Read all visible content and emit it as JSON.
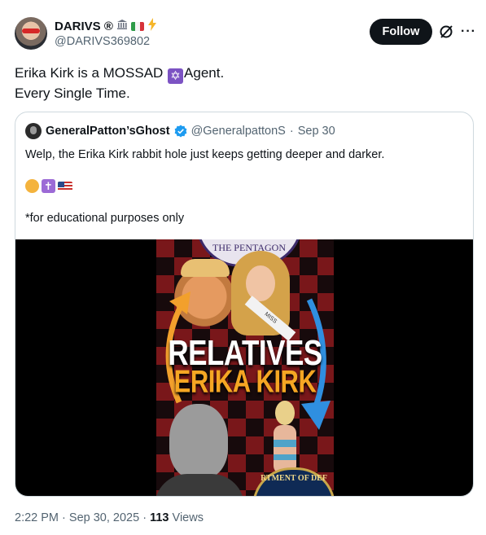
{
  "author": {
    "display_name": "DARIVS ®",
    "handle": "@DARIVS369802",
    "name_emojis": [
      "classical-building",
      "italy-flag",
      "high-voltage"
    ]
  },
  "follow_label": "Follow",
  "tweet": {
    "line1_before": "Erika Kirk is a MOSSAD",
    "line1_emoji": "✡",
    "line1_after": "Agent.",
    "line2": "Every Single Time."
  },
  "quoted": {
    "display_name": "GeneralPatton’sGhost",
    "handle": "@GeneralpattonS",
    "separator": "·",
    "date": "Sep 30",
    "text": "Welp, the Erika Kirk rabbit hole just keeps getting deeper and darker.",
    "emojis": [
      "smiling-face",
      "latin-cross",
      "us-flag"
    ],
    "cross_glyph": "✝",
    "note": "*for educational purposes only",
    "media": {
      "headline_1": "RELATIVES",
      "headline_2": "ERIKA KIRK",
      "seal_top_text": "THE PENTAGON",
      "seal_bottom_text": "RTMENT OF DEF",
      "sash_text": "MISS"
    }
  },
  "footer": {
    "time": "2:22 PM",
    "sep1": "·",
    "date": "Sep 30, 2025",
    "sep2": "·",
    "views_count": "113",
    "views_label": "Views"
  },
  "colors": {
    "follow_bg": "#0f1419",
    "verified": "#1d9bf0",
    "headline_orange": "#f5a623",
    "arrow_blue": "#2f8fe0",
    "arrow_orange": "#f2a02c"
  }
}
